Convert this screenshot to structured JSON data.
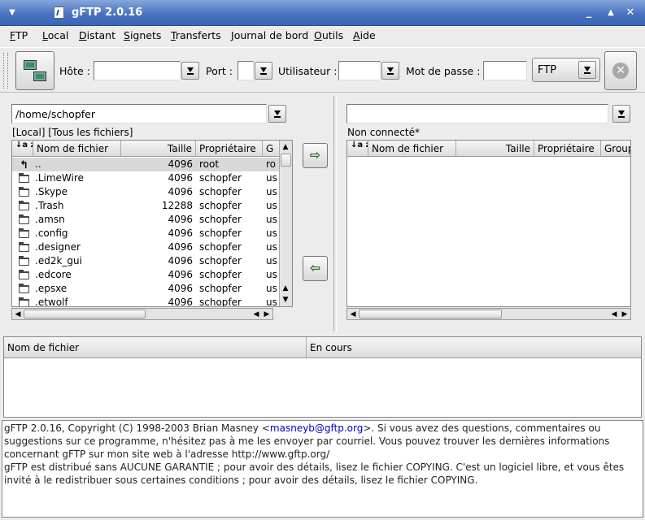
{
  "window": {
    "title": "gFTP 2.0.16",
    "menu_glyph": "▼",
    "minimize_glyph": "_",
    "maximize_glyph": "▲",
    "close_glyph": "✕",
    "title_gradient": [
      "#86a6d9",
      "#3b64b5"
    ]
  },
  "menu": {
    "items": [
      {
        "accel": "F",
        "rest": "TP"
      },
      {
        "accel": "L",
        "rest": "ocal"
      },
      {
        "accel": "D",
        "rest": "istant"
      },
      {
        "accel": "S",
        "rest": "ignets"
      },
      {
        "accel": "T",
        "rest": "ransferts"
      },
      {
        "accel": "J",
        "rest": "ournal de bord"
      },
      {
        "accel": "O",
        "rest": "utils"
      },
      {
        "accel": "A",
        "rest": "ide"
      }
    ]
  },
  "toolbar": {
    "host_label": "Hôte :",
    "host_value": "",
    "port_label": "Port :",
    "port_value": "",
    "user_label": "Utilisateur :",
    "user_value": "",
    "pass_label": "Mot de passe :",
    "pass_value": "",
    "protocol": "FTP",
    "stop_glyph": "✕"
  },
  "local": {
    "path": "/home/schopfer",
    "status": "[Local] [Tous les fichiers]",
    "sort_glyph": "↓a z",
    "columns": [
      "Nom de fichier",
      "Taille",
      "Propriétaire",
      "G"
    ],
    "rows": [
      {
        "name": "..",
        "size": "4096",
        "owner": "root",
        "group": "ro",
        "type": "up"
      },
      {
        "name": ".LimeWire",
        "size": "4096",
        "owner": "schopfer",
        "group": "us",
        "type": "folder"
      },
      {
        "name": ".Skype",
        "size": "4096",
        "owner": "schopfer",
        "group": "us",
        "type": "folder"
      },
      {
        "name": ".Trash",
        "size": "12288",
        "owner": "schopfer",
        "group": "us",
        "type": "folder"
      },
      {
        "name": ".amsn",
        "size": "4096",
        "owner": "schopfer",
        "group": "us",
        "type": "folder"
      },
      {
        "name": ".config",
        "size": "4096",
        "owner": "schopfer",
        "group": "us",
        "type": "folder"
      },
      {
        "name": ".designer",
        "size": "4096",
        "owner": "schopfer",
        "group": "us",
        "type": "folder"
      },
      {
        "name": ".ed2k_gui",
        "size": "4096",
        "owner": "schopfer",
        "group": "us",
        "type": "folder"
      },
      {
        "name": ".edcore",
        "size": "4096",
        "owner": "schopfer",
        "group": "us",
        "type": "folder"
      },
      {
        "name": ".epsxe",
        "size": "4096",
        "owner": "schopfer",
        "group": "us",
        "type": "folder"
      },
      {
        "name": ".etwolf",
        "size": "4096",
        "owner": "schopfer",
        "group": "us",
        "type": "folder"
      }
    ]
  },
  "remote": {
    "path": "",
    "status": "Non connecté*",
    "sort_glyph": "↓a z",
    "columns": [
      "Nom de fichier",
      "Taille",
      "Propriétaire",
      "Groupe"
    ]
  },
  "transfer": {
    "upload_glyph": "⇨",
    "download_glyph": "⇦"
  },
  "queue": {
    "columns": [
      "Nom de fichier",
      "En cours"
    ]
  },
  "log": {
    "line1_pre": "gFTP 2.0.16, Copyright (C) 1998-2003 Brian Masney <",
    "line1_email": "masneyb@gftp.org",
    "line1_post": ">. Si vous avez des questions, commentaires ou",
    "line2": "suggestions sur ce programme, n'hésitez pas à me les envoyer par courriel.  Vous pouvez trouver les dernières informations",
    "line3": "concernant gFTP sur mon site web à l'adresse http://www.gftp.org/",
    "line4": "gFTP est distribué sans AUCUNE GARANTIE ; pour avoir des détails, lisez le fichier COPYING. C'est un logiciel libre, et vous êtes",
    "line5": "invité à le redistribuer sous certaines conditions ; pour avoir des détails, lisez le fichier COPYING."
  }
}
